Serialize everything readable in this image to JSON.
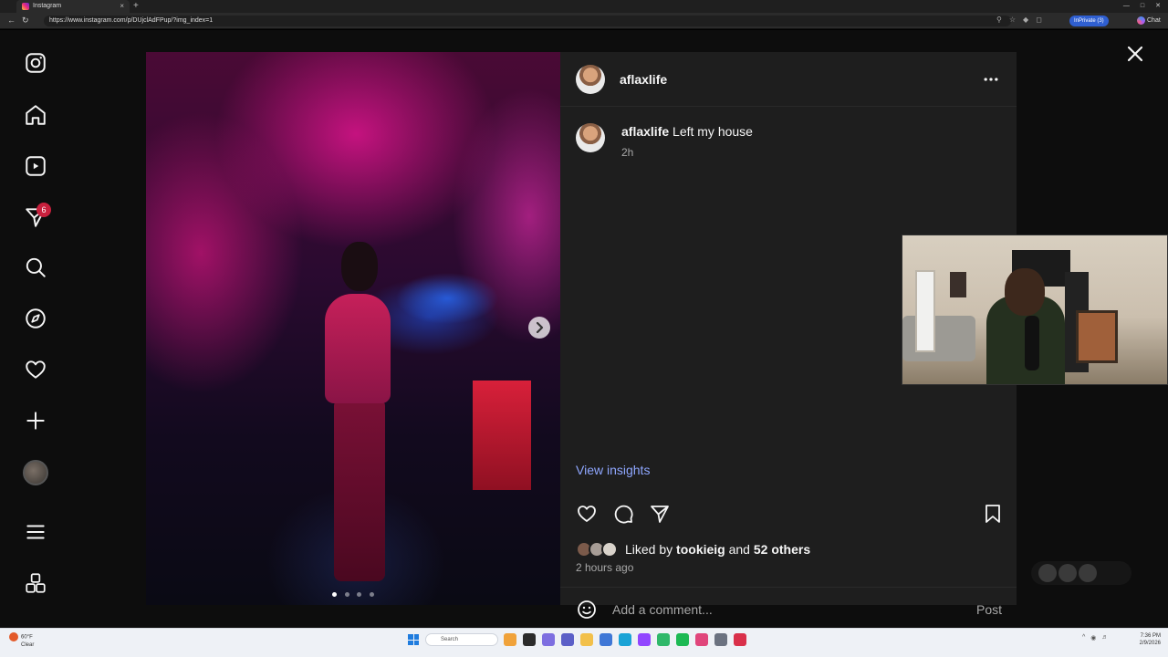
{
  "browser": {
    "tab_title": "Instagram",
    "url": "https://www.instagram.com/p/DUjclAdFPup/?img_index=1",
    "inprivate_label": "InPrivate (3)",
    "chat_label": "Chat",
    "close_tab": "×",
    "new_tab": "+"
  },
  "sidebar": {
    "items": [
      {
        "name": "instagram-logo-icon"
      },
      {
        "name": "home-icon"
      },
      {
        "name": "reels-icon"
      },
      {
        "name": "messages-icon"
      },
      {
        "name": "search-icon"
      },
      {
        "name": "explore-icon"
      },
      {
        "name": "notifications-icon"
      },
      {
        "name": "create-icon"
      },
      {
        "name": "profile-avatar"
      },
      {
        "name": "menu-icon"
      },
      {
        "name": "also-from-meta-icon"
      }
    ],
    "messages_badge": "6"
  },
  "post": {
    "username": "aflaxlife",
    "caption_user": "aflaxlife",
    "caption_text": "Left my house",
    "caption_time": "2h",
    "view_insights": "View insights",
    "liked_by_prefix": "Liked by",
    "liked_by_user": "tookieig",
    "liked_by_and": "and",
    "liked_by_others": "52 others",
    "post_age": "2 hours ago",
    "comment_placeholder": "Add a comment...",
    "post_button": "Post",
    "carousel_count": 4,
    "carousel_active_index": 0
  },
  "colors": {
    "accent_link": "#8fa7ff",
    "panel_bg": "#1e1e1e",
    "badge_red": "#c8203d"
  },
  "taskbar": {
    "weather_temp": "60°F",
    "weather_desc": "Clear",
    "search_label": "Search",
    "time": "7:36 PM",
    "date": "2/9/2026"
  }
}
